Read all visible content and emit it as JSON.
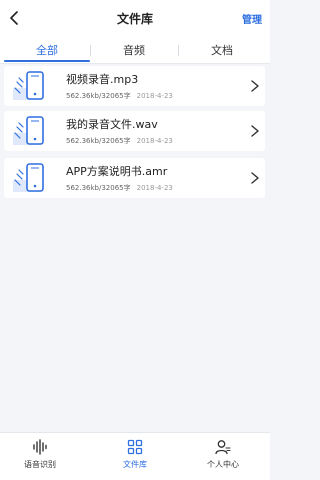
{
  "header": {
    "title": "文件库",
    "manage_label": "管理",
    "back_icon": "chevron-left-icon"
  },
  "tabs": [
    {
      "label": "全部",
      "active": true
    },
    {
      "label": "音频",
      "active": false
    },
    {
      "label": "文档",
      "active": false
    }
  ],
  "files": [
    {
      "name": "视频录音.mp3",
      "size": "562.36kb/32065字",
      "date": "2018-4-23",
      "icon": "audio-file-icon"
    },
    {
      "name": "我的录音文件.wav",
      "size": "562.36kb/32065字",
      "date": "2018-4-23",
      "icon": "audio-file-icon"
    },
    {
      "name": "APP方案说明书.amr",
      "size": "562.36kb/32065字",
      "date": "2018-4-23",
      "icon": "audio-file-icon"
    }
  ],
  "bottom_nav": [
    {
      "label": "语音识别",
      "icon": "waveform-icon",
      "active": false
    },
    {
      "label": "文件库",
      "icon": "grid-icon",
      "active": true
    },
    {
      "label": "个人中心",
      "icon": "user-icon",
      "active": false
    }
  ],
  "colors": {
    "accent": "#2f6fe0",
    "background": "#f3f5f8",
    "card": "#ffffff"
  }
}
